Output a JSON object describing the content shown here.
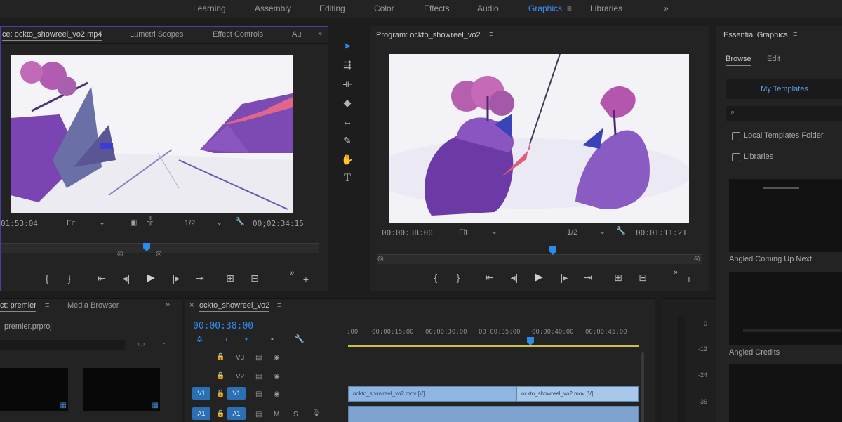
{
  "workspaces": {
    "items": [
      "Learning",
      "Assembly",
      "Editing",
      "Color",
      "Effects",
      "Audio",
      "Graphics",
      "Libraries"
    ],
    "active": "Graphics",
    "menu_glyph": "≡",
    "overflow": "»"
  },
  "source_monitor": {
    "tabs": [
      "ce: ockto_showreel_vo2.mp4",
      "Lumetri Scopes",
      "Effect Controls",
      "Au"
    ],
    "overflow": "»",
    "timecode_left": "01:53:04",
    "fit": "Fit",
    "resolution": "1/2",
    "timecode_right": "00;02:34:15"
  },
  "program_monitor": {
    "title": "Program: ockto_showreel_vo2",
    "timecode_left": "00:00:38:00",
    "fit": "Fit",
    "resolution": "1/2",
    "timecode_right": "00:01:11:21"
  },
  "essential_graphics": {
    "title": "Essential Graphics",
    "tabs": [
      "Browse",
      "Edit"
    ],
    "my_templates": "My Templates",
    "options": [
      "Local Templates Folder",
      "Libraries"
    ],
    "templates": [
      "Angled Coming Up Next",
      "Angled Credits"
    ]
  },
  "project_panel": {
    "tabs": [
      "ct: premier",
      "Media Browser"
    ],
    "file": "premier.prproj",
    "overflow": "»"
  },
  "timeline": {
    "sequence": "ockto_showreel_vo2",
    "timecode": "00:00:38:00",
    "ruler": [
      ":00",
      "00:00:15:00",
      "00:00:30:00",
      "00:00:35:00",
      "00:00:40:00",
      "00:00:45:00"
    ],
    "tracks": [
      "V3",
      "V2",
      "V1",
      "A1"
    ],
    "clips": [
      "ockto_showreel_vo2.mov [V]",
      "ockto_showreel_vo2.mov [V]"
    ]
  },
  "audio_meter": {
    "labels": [
      "0",
      "-12",
      "-24",
      "-36"
    ]
  },
  "colors": {
    "accent": "#2d8ceb",
    "panel": "#232323",
    "source_border": "#4a3fa3"
  }
}
